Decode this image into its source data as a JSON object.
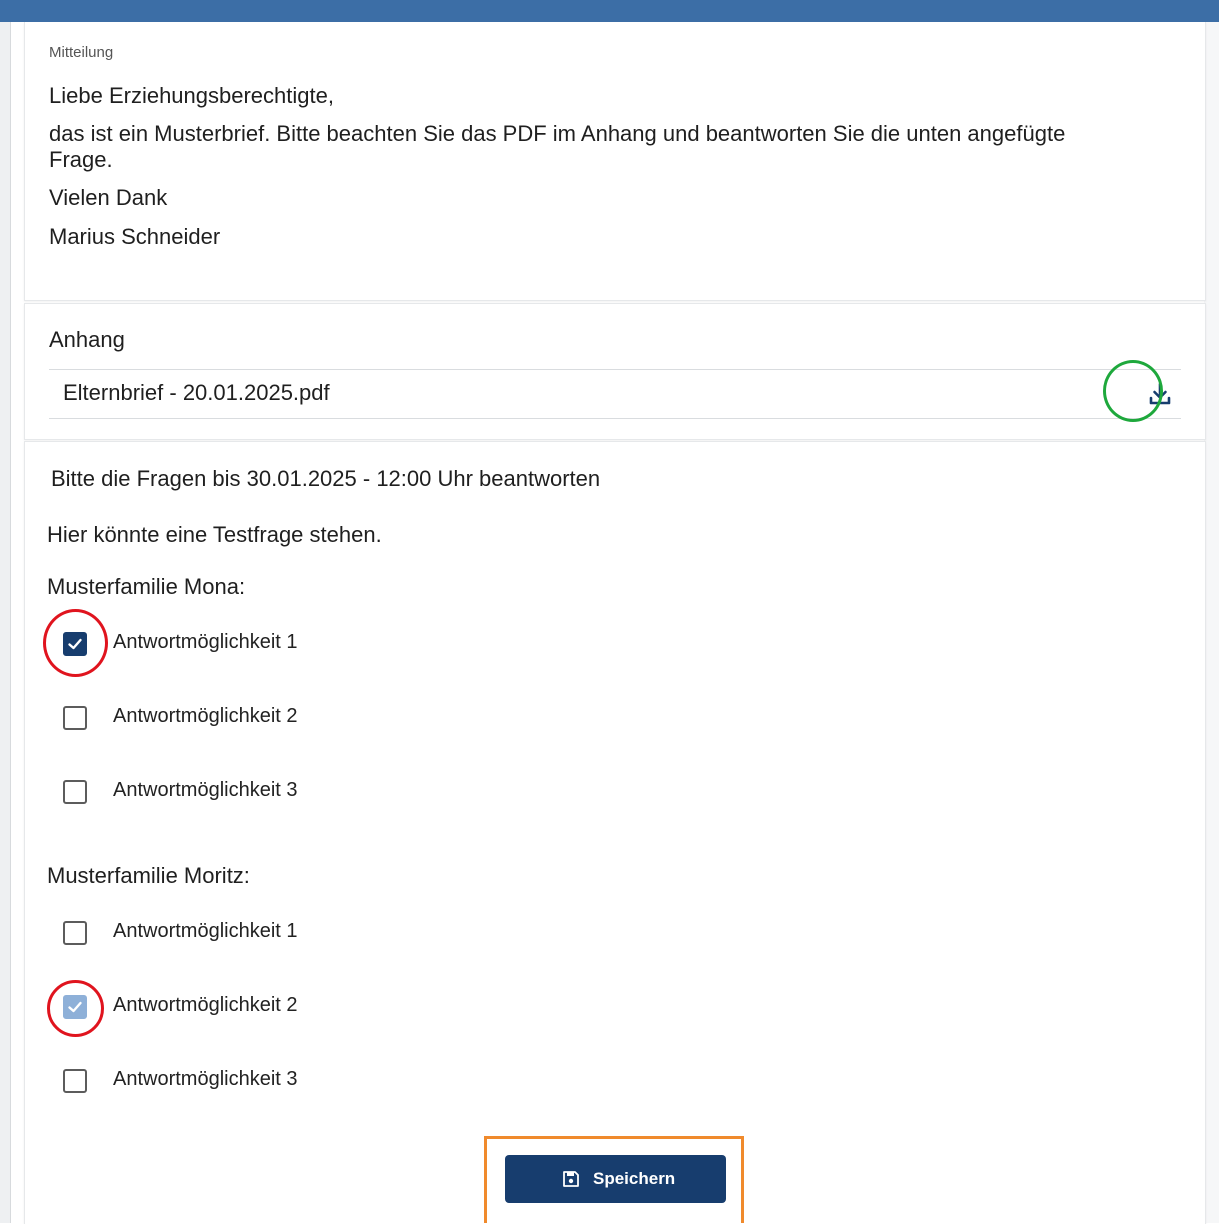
{
  "message": {
    "section_label": "Mitteilung",
    "lines": [
      "Liebe Erziehungsberechtigte,",
      "das ist ein Musterbrief. Bitte beachten Sie das PDF im Anhang und beantworten Sie die unten angefügte",
      "Frage.",
      "Vielen Dank",
      "Marius Schneider"
    ]
  },
  "attachment": {
    "section_label": "Anhang",
    "file_name": "Elternbrief - 20.01.2025.pdf",
    "download_icon": "download-icon"
  },
  "questions": {
    "deadline": "Bitte die Fragen bis 30.01.2025 - 12:00 Uhr beantworten",
    "question_text": "Hier könnte eine Testfrage stehen.",
    "groups": [
      {
        "name": "Musterfamilie Mona:",
        "options": [
          {
            "label": "Antwortmöglichkeit 1",
            "checked": true
          },
          {
            "label": "Antwortmöglichkeit 2",
            "checked": false
          },
          {
            "label": "Antwortmöglichkeit 3",
            "checked": false
          }
        ]
      },
      {
        "name": "Musterfamilie Moritz:",
        "options": [
          {
            "label": "Antwortmöglichkeit 1",
            "checked": false
          },
          {
            "label": "Antwortmöglichkeit 2",
            "checked": true
          },
          {
            "label": "Antwortmöglichkeit 3",
            "checked": false
          }
        ]
      }
    ]
  },
  "save_button": {
    "label": "Speichern",
    "icon": "floppy-disk-icon"
  },
  "colors": {
    "header_bar": "#3c6ea6",
    "primary": "#173d6e",
    "checkbox_checked_light": "#8eb0d8",
    "highlight_green": "#1ea83c",
    "highlight_red": "#e0141e",
    "highlight_orange": "#f08a2c"
  }
}
